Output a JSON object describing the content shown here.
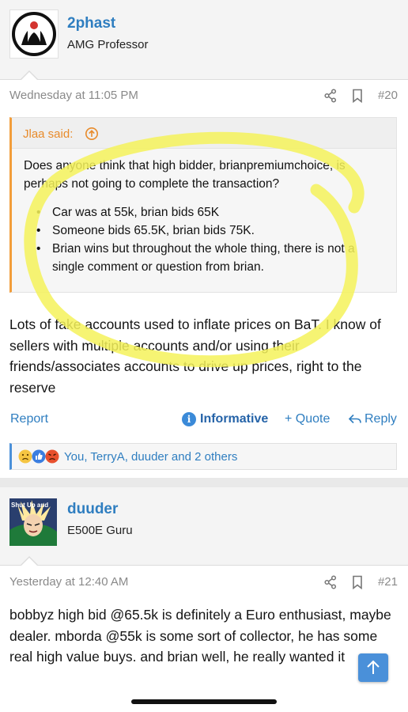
{
  "post1": {
    "username": "2phast",
    "user_title": "AMG Professor",
    "date": "Wednesday at 11:05 PM",
    "post_number": "#20",
    "quote": {
      "author": "Jlaa said:",
      "text": "Does anyone think that high bidder, brianpremiumchoice, is perhaps not going to complete the transaction?",
      "items": [
        "Car was at 55k, brian bids 65K",
        "Someone bids 65.5K, brian bids 75K.",
        "Brian wins but throughout the whole thing, there is not a single comment or question from brian."
      ]
    },
    "body": "Lots of fake accounts used to inflate prices on BaT. I know of sellers with multiple accounts and/or using their friends/associates accounts to drive up prices, right to the reserve",
    "actions": {
      "report": "Report",
      "informative": "Informative",
      "quote": "+ Quote",
      "reply": "Reply"
    },
    "reactions": {
      "text": "You, TerryA, duuder and 2 others",
      "icons": [
        "sad-face-icon",
        "like-icon",
        "angry-face-icon"
      ]
    }
  },
  "post2": {
    "username": "duuder",
    "user_title": "E500E Guru",
    "avatar_caption": "Shut Up and",
    "date": "Yesterday at 12:40 AM",
    "post_number": "#21",
    "body": "bobbyz high bid @65.5k is definitely a Euro enthusiast, maybe dealer. mborda @55k is some sort of collector, he has some real high value buys. and brian well, he really wanted it"
  },
  "colors": {
    "link_blue": "#2f7ec0",
    "quote_accent": "#f29d3a",
    "highlight_yellow": "#f4f25a",
    "meta_gray": "#8a8a8a"
  }
}
